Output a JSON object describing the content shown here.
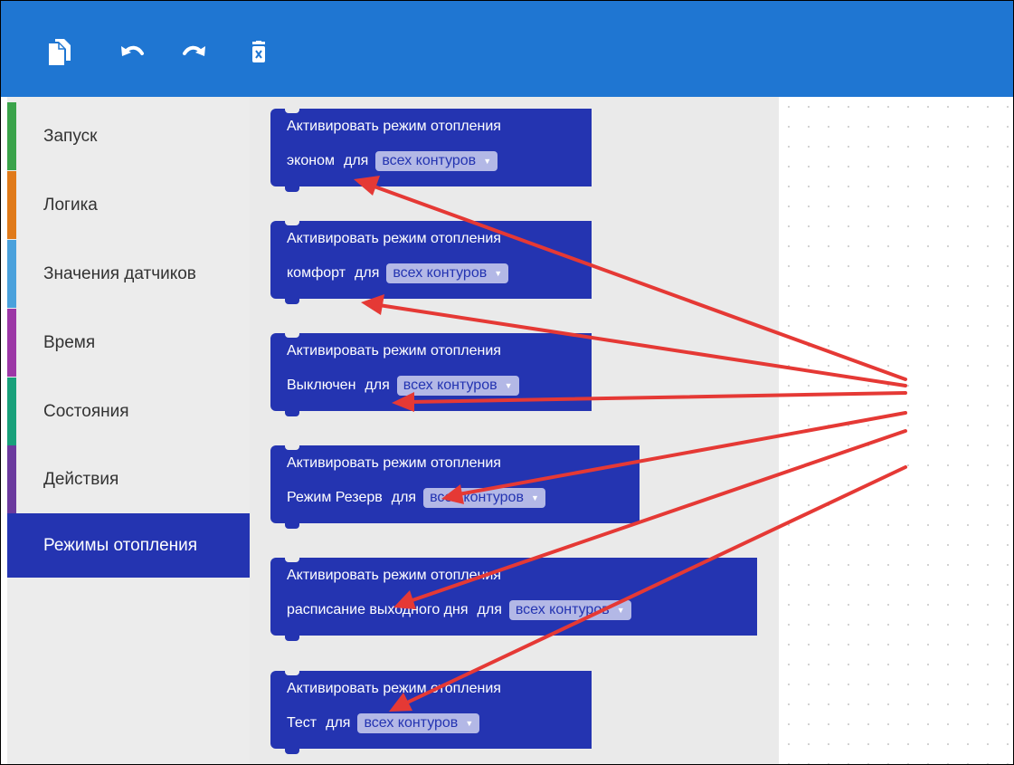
{
  "colors": {
    "toolbar": "#1f76d2",
    "block": "#2434b1",
    "selected_category": "#2434b1",
    "annotation_arrow": "#e53935"
  },
  "toolbar": {
    "icons": [
      "copy-icon",
      "undo-icon",
      "redo-icon",
      "trash-icon"
    ]
  },
  "sidebar": {
    "categories": [
      {
        "label": "Запуск",
        "color": "#3aa34a"
      },
      {
        "label": "Логика",
        "color": "#e07a1a"
      },
      {
        "label": "Значения датчиков",
        "color": "#4aa1dc"
      },
      {
        "label": "Время",
        "color": "#9c37a6"
      },
      {
        "label": "Состояния",
        "color": "#18a07a"
      },
      {
        "label": "Действия",
        "color": "#6b3a9e"
      },
      {
        "label": "Режимы отопления",
        "color": "#2434b1",
        "selected": true
      }
    ]
  },
  "blocks": [
    {
      "line1": "Активировать режим отопления",
      "mode": "эконом",
      "for": "для",
      "target": "всех контуров"
    },
    {
      "line1": "Активировать режим отопления",
      "mode": "комфорт",
      "for": "для",
      "target": "всех контуров"
    },
    {
      "line1": "Активировать режим отопления",
      "mode": "Выключен",
      "for": "для",
      "target": "всех контуров"
    },
    {
      "line1": "Активировать режим отопления",
      "mode": "Режим Резерв",
      "for": "для",
      "target": "всех контуров"
    },
    {
      "line1": "Активировать режим отопления",
      "mode": "расписание выходного дня",
      "for": "для",
      "target": "всех контуров"
    },
    {
      "line1": "Активировать режим отопления",
      "mode": "Тест",
      "for": "для",
      "target": "всех контуров"
    }
  ]
}
